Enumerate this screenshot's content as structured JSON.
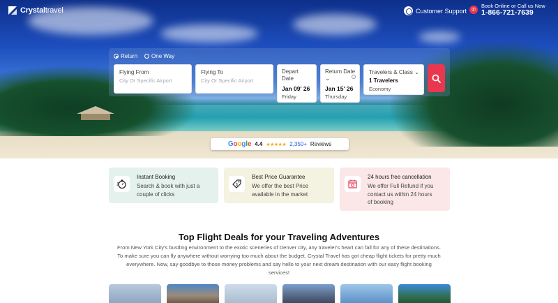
{
  "header": {
    "logo_bold": "Crystal",
    "logo_light": "travel",
    "support_label": "Customer Support",
    "phone_small": "Book Online or Call us Now",
    "phone_number": "1-866-721-7639"
  },
  "search": {
    "trip_types": [
      "Return",
      "One Way"
    ],
    "selected_trip": "Return",
    "from_label": "Flying From",
    "from_placeholder": "City Or Specific Airport",
    "to_label": "Flying To",
    "to_placeholder": "City Or Specific Airport",
    "depart_label_1": "Depart",
    "depart_label_2": "Date",
    "depart_date": "Jan 09' 26",
    "depart_day": "Friday",
    "return_label": "Return Date",
    "return_date": "Jan 15' 26",
    "return_day": "Thursday",
    "travelers_label": "Travelers & Class",
    "travelers_value": "1 Travelers",
    "class_value": "Economy"
  },
  "rating": {
    "brand": "Google",
    "score": "4.4",
    "stars": "★★★★★",
    "reviews_count": "2,350+",
    "reviews_label": "Reviews"
  },
  "features": [
    {
      "title": "Instant Booking",
      "lines": [
        "Search & book with just a",
        "couple of clicks"
      ],
      "icon": "stopwatch-icon"
    },
    {
      "title": "Best Price Guarantee",
      "lines": [
        "We offer the best Price",
        "available in the market"
      ],
      "icon": "price-tag-icon"
    },
    {
      "title": "24 hours free cancellation",
      "lines": [
        "We offer Full Refund if you",
        "contact us within 24 hours",
        "of booking"
      ],
      "icon": "calendar-cancel-icon"
    }
  ],
  "deals": {
    "title": "Top Flight Deals for your Traveling Adventures",
    "description": "From New York City's bustling environment to the exotic sceneries of Denver city, any traveler's heart can fall for any of these destinations. To make sure you can fly anywhere without worrying too much about the budget, Crystal Travel has got cheap flight tickets for pretty much everywhere. Now, say goodbye to those money problems and say hello to your next dream destination with our easy flight booking services!"
  },
  "colors": {
    "accent": "#e8374f",
    "link": "#1a56db",
    "card_green": "#e5f1ec",
    "card_yellow": "#f4f2e0",
    "card_pink": "#fbe7e8"
  }
}
